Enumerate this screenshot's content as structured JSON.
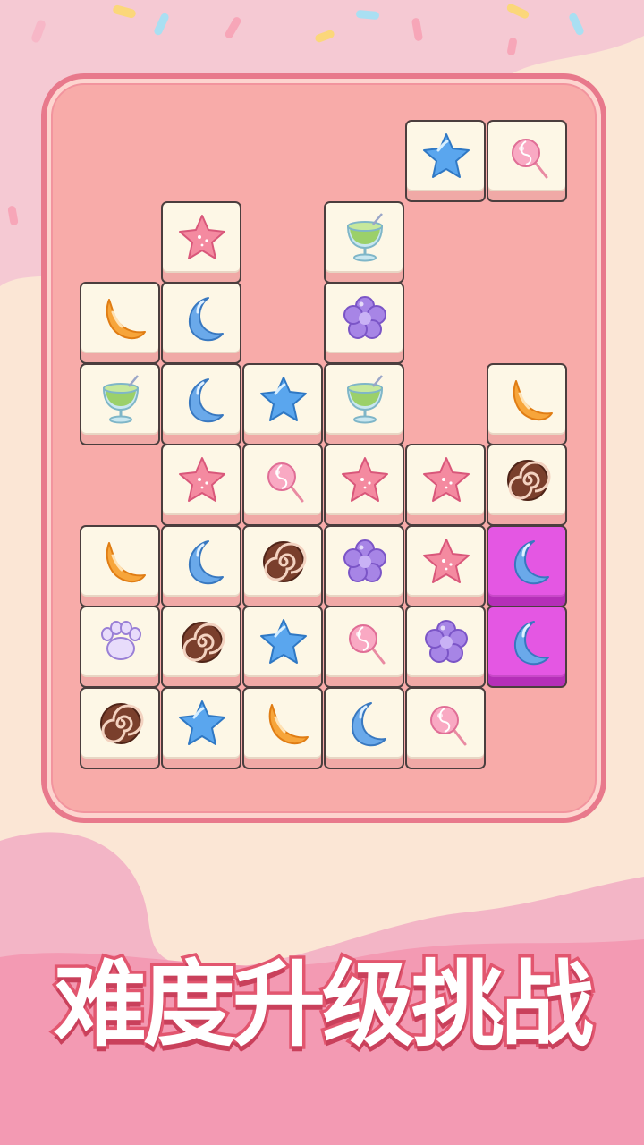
{
  "colors": {
    "background_top": "#f5c9d3",
    "background_bottom": "#f39ab3",
    "board": "#f8aba9",
    "board_border": "#e8798c",
    "tile_face": "#fdf7e6",
    "tile_selected": "#e457e3"
  },
  "title": "难度升级挑战",
  "board": {
    "tiles": [
      {
        "row": 0,
        "col": 4,
        "icon": "star-blue-icon"
      },
      {
        "row": 0,
        "col": 5,
        "icon": "lollipop-icon"
      },
      {
        "row": 1,
        "col": 1,
        "icon": "star-pink-icon"
      },
      {
        "row": 1,
        "col": 3,
        "icon": "green-drink-icon"
      },
      {
        "row": 2,
        "col": 0,
        "icon": "moon-orange-icon"
      },
      {
        "row": 2,
        "col": 1,
        "icon": "moon-blue-icon"
      },
      {
        "row": 2,
        "col": 3,
        "icon": "flower-purple-icon"
      },
      {
        "row": 3,
        "col": 0,
        "icon": "green-drink-icon"
      },
      {
        "row": 3,
        "col": 1,
        "icon": "moon-blue-icon"
      },
      {
        "row": 3,
        "col": 2,
        "icon": "star-blue-icon"
      },
      {
        "row": 3,
        "col": 3,
        "icon": "green-drink-icon"
      },
      {
        "row": 3,
        "col": 5,
        "icon": "moon-orange-icon"
      },
      {
        "row": 4,
        "col": 1,
        "icon": "star-pink-icon"
      },
      {
        "row": 4,
        "col": 2,
        "icon": "lollipop-icon"
      },
      {
        "row": 4,
        "col": 3,
        "icon": "star-pink-icon"
      },
      {
        "row": 4,
        "col": 4,
        "icon": "star-pink-icon"
      },
      {
        "row": 4,
        "col": 5,
        "icon": "chocolate-swirl-icon"
      },
      {
        "row": 5,
        "col": 0,
        "icon": "moon-orange-icon"
      },
      {
        "row": 5,
        "col": 1,
        "icon": "moon-blue-icon"
      },
      {
        "row": 5,
        "col": 2,
        "icon": "chocolate-swirl-icon"
      },
      {
        "row": 5,
        "col": 3,
        "icon": "flower-purple-icon"
      },
      {
        "row": 5,
        "col": 4,
        "icon": "star-pink-icon"
      },
      {
        "row": 5,
        "col": 5,
        "icon": "moon-blue-icon",
        "selected": true
      },
      {
        "row": 6,
        "col": 0,
        "icon": "paw-purple-icon"
      },
      {
        "row": 6,
        "col": 1,
        "icon": "chocolate-swirl-icon"
      },
      {
        "row": 6,
        "col": 2,
        "icon": "star-blue-icon"
      },
      {
        "row": 6,
        "col": 3,
        "icon": "lollipop-icon"
      },
      {
        "row": 6,
        "col": 4,
        "icon": "flower-purple-icon"
      },
      {
        "row": 6,
        "col": 5,
        "icon": "moon-blue-icon",
        "selected": true
      },
      {
        "row": 7,
        "col": 0,
        "icon": "chocolate-swirl-icon"
      },
      {
        "row": 7,
        "col": 1,
        "icon": "star-blue-icon"
      },
      {
        "row": 7,
        "col": 2,
        "icon": "moon-orange-icon"
      },
      {
        "row": 7,
        "col": 3,
        "icon": "moon-blue-icon"
      },
      {
        "row": 7,
        "col": 4,
        "icon": "lollipop-icon"
      }
    ]
  }
}
